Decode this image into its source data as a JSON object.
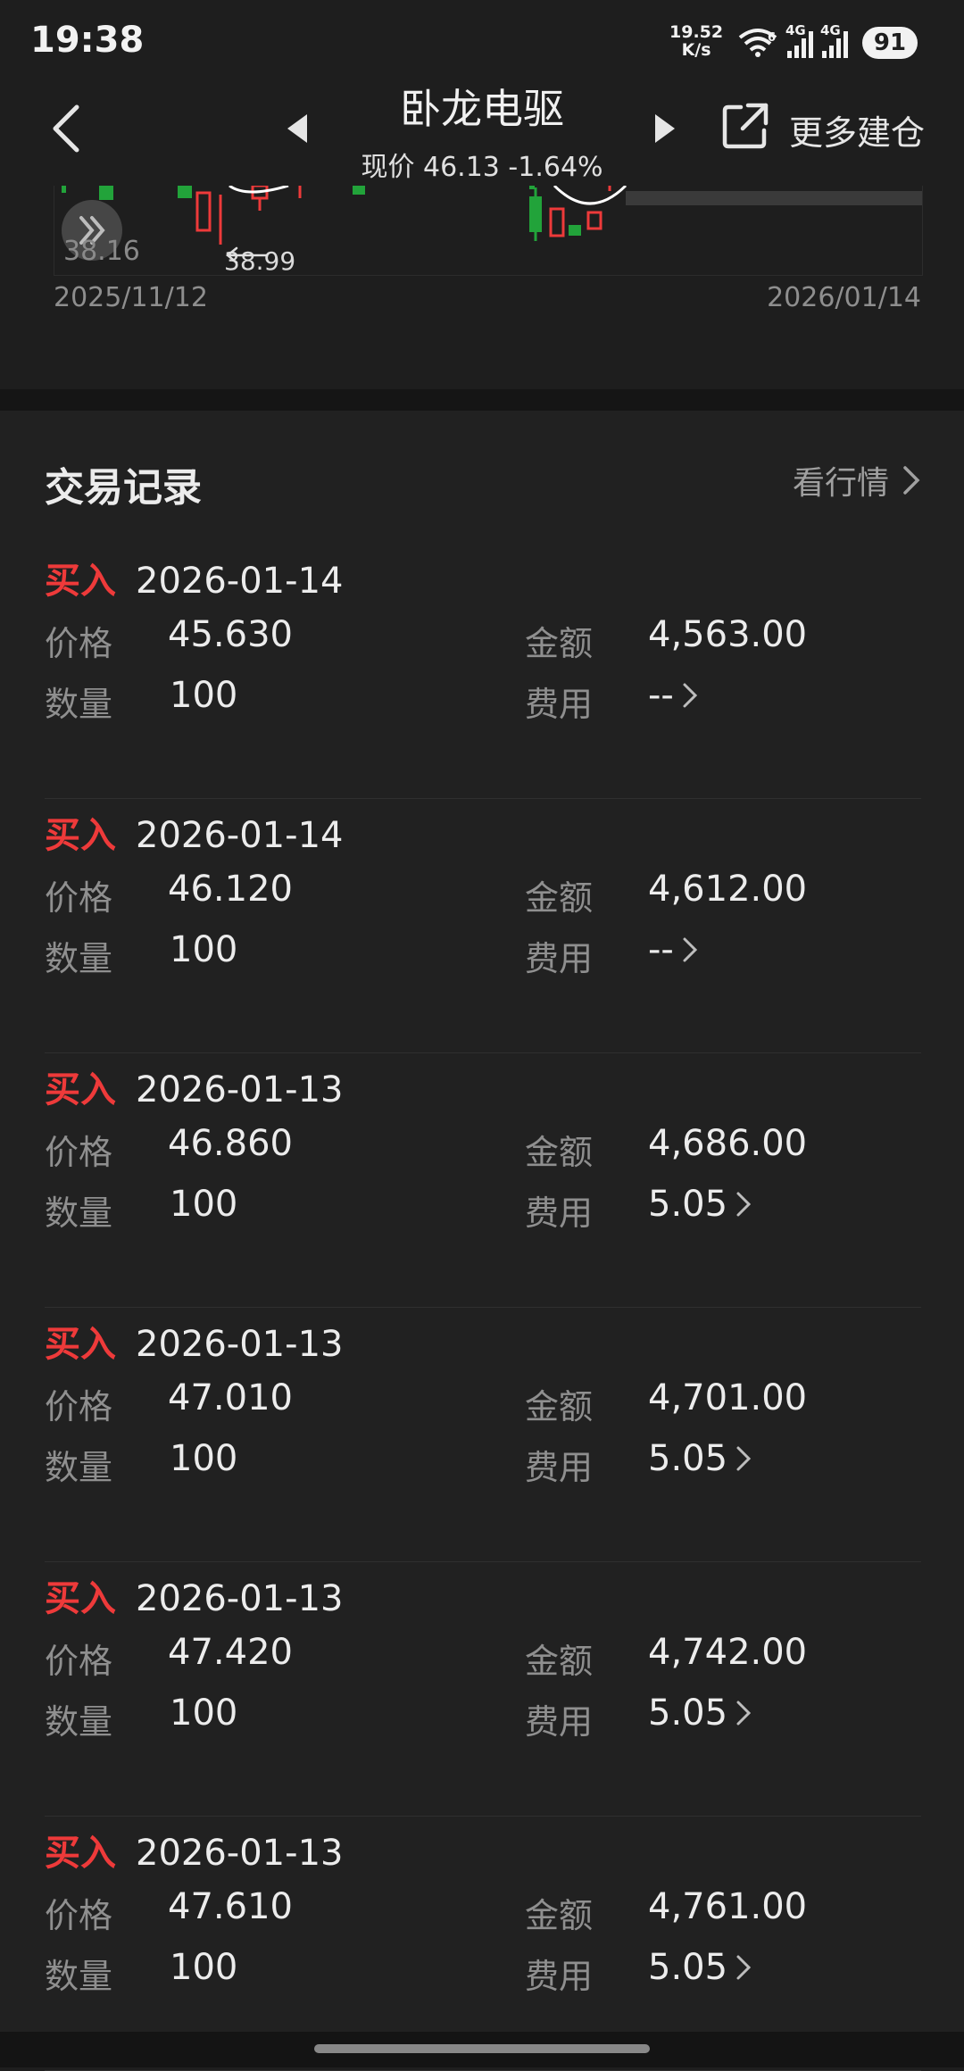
{
  "status": {
    "time": "19:38",
    "speed_value": "19.52",
    "speed_unit": "K/s",
    "wifi_badge": "6",
    "net1": "4G",
    "net2": "4G",
    "battery": "91"
  },
  "header": {
    "title": "卧龙电驱",
    "subtitle": "现价 46.13 -1.64%",
    "more_label": "更多建仓"
  },
  "chart": {
    "low_label": "38.16",
    "min_marker": "38.99",
    "date_start": "2025/11/12",
    "date_end": "2026/01/14",
    "up_color": "#ee3a3a",
    "down_color": "#22a33a"
  },
  "section": {
    "title": "交易记录",
    "market_link": "看行情"
  },
  "labels": {
    "price": "价格",
    "quantity": "数量",
    "amount": "金额",
    "fee": "费用"
  },
  "records": [
    {
      "type": "买入",
      "date": "2026-01-14",
      "price": "45.630",
      "quantity": "100",
      "amount": "4,563.00",
      "fee": "--"
    },
    {
      "type": "买入",
      "date": "2026-01-14",
      "price": "46.120",
      "quantity": "100",
      "amount": "4,612.00",
      "fee": "--"
    },
    {
      "type": "买入",
      "date": "2026-01-13",
      "price": "46.860",
      "quantity": "100",
      "amount": "4,686.00",
      "fee": "5.05"
    },
    {
      "type": "买入",
      "date": "2026-01-13",
      "price": "47.010",
      "quantity": "100",
      "amount": "4,701.00",
      "fee": "5.05"
    },
    {
      "type": "买入",
      "date": "2026-01-13",
      "price": "47.420",
      "quantity": "100",
      "amount": "4,742.00",
      "fee": "5.05"
    },
    {
      "type": "买入",
      "date": "2026-01-13",
      "price": "47.610",
      "quantity": "100",
      "amount": "4,761.00",
      "fee": "5.05"
    }
  ]
}
